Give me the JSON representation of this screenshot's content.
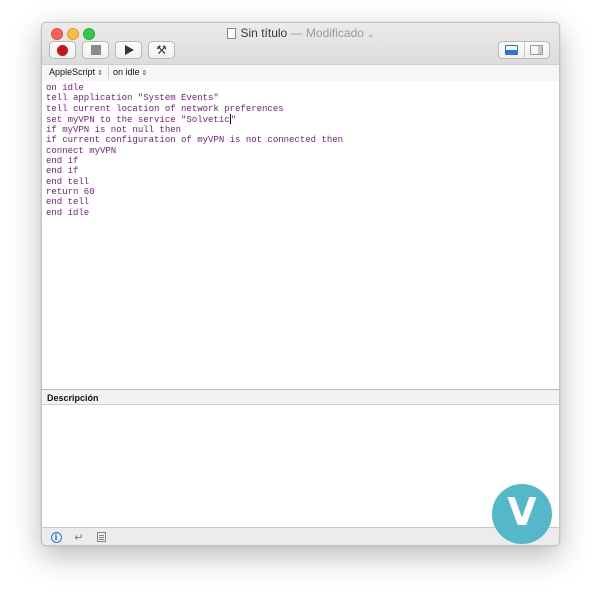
{
  "window": {
    "title": "Sin título",
    "separator": "—",
    "status": "Modificado"
  },
  "toolbar": {
    "buttons": [
      {
        "name": "record",
        "icon": "record-icon"
      },
      {
        "name": "stop",
        "icon": "stop-icon"
      },
      {
        "name": "run",
        "icon": "play-icon"
      },
      {
        "name": "compile",
        "icon": "hammer-icon"
      }
    ],
    "view_toggle": [
      "show-bottom-pane-icon",
      "show-side-pane-icon"
    ]
  },
  "navigation": {
    "language": "AppleScript",
    "handler": "on idle"
  },
  "editor": {
    "text_color": "#7a1e8a",
    "lines": [
      "on idle",
      "tell application \"System Events\"",
      "tell current location of network preferences",
      "set myVPN to the service \"Solvetic\"",
      "if myVPN is not null then",
      "if current configuration of myVPN is not connected then",
      "connect myVPN",
      "end if",
      "end if",
      "end tell",
      "return 60",
      "end tell",
      "end idle"
    ]
  },
  "description": {
    "header": "Descripción",
    "content": ""
  },
  "bottom_bar": {
    "buttons": [
      "info-icon",
      "reply-icon",
      "list-icon"
    ]
  },
  "watermark": {
    "letter": "V",
    "color": "#55b8c9"
  }
}
